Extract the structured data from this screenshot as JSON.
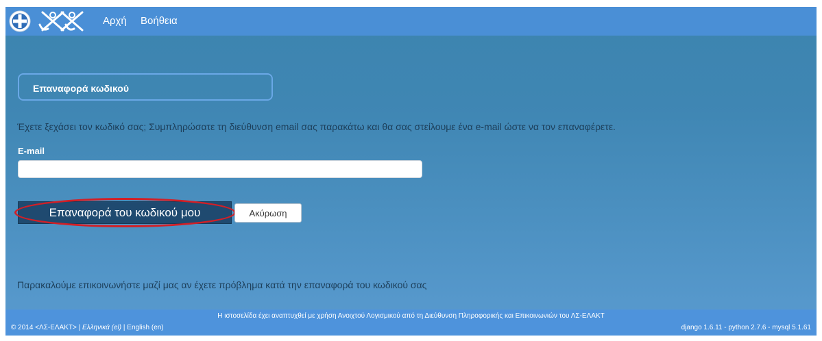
{
  "header": {
    "nav": [
      {
        "label": "Αρχή"
      },
      {
        "label": "Βοήθεια"
      }
    ]
  },
  "main": {
    "title": "Επαναφορά κωδικού",
    "info": "Έχετε ξεχάσει τον κωδικό σας; Συμπληρώσατε τη διεύθυνση email σας παρακάτω και θα σας στείλουμε ένα e-mail ώστε να τον επαναφέρετε.",
    "email_label": "E-mail",
    "email_value": "",
    "reset_button": "Επαναφορά του κωδικού μου",
    "cancel_button": "Ακύρωση",
    "contact": "Παρακαλούμε επικοινωνήστε μαζί μας αν έχετε πρόβλημα κατά την επαναφορά του κωδικού σας"
  },
  "footer": {
    "note": "Η ιστοσελίδα έχει αναπτυχθεί με χρήση Ανοιχτού Λογισμικού από τη Διεύθυνση Πληροφορικής και Επικοινωνιών του ΛΣ-ΕΛΑΚΤ",
    "copyright": "© 2014 <ΛΣ-ΕΛΑΚΤ>",
    "lang_el": "Ελληνικά (el)",
    "lang_en": "English (en)",
    "sep": "|",
    "versions": "django 1.6.11 - python 2.7.6 - mysql 5.1.61"
  },
  "colors": {
    "topbar": "#4a8fd6",
    "button": "#1f4a70",
    "highlight": "#d21f26"
  },
  "icons": [
    "greek-coat-of-arms-icon",
    "coast-guard-anchor-emblem-icon"
  ]
}
